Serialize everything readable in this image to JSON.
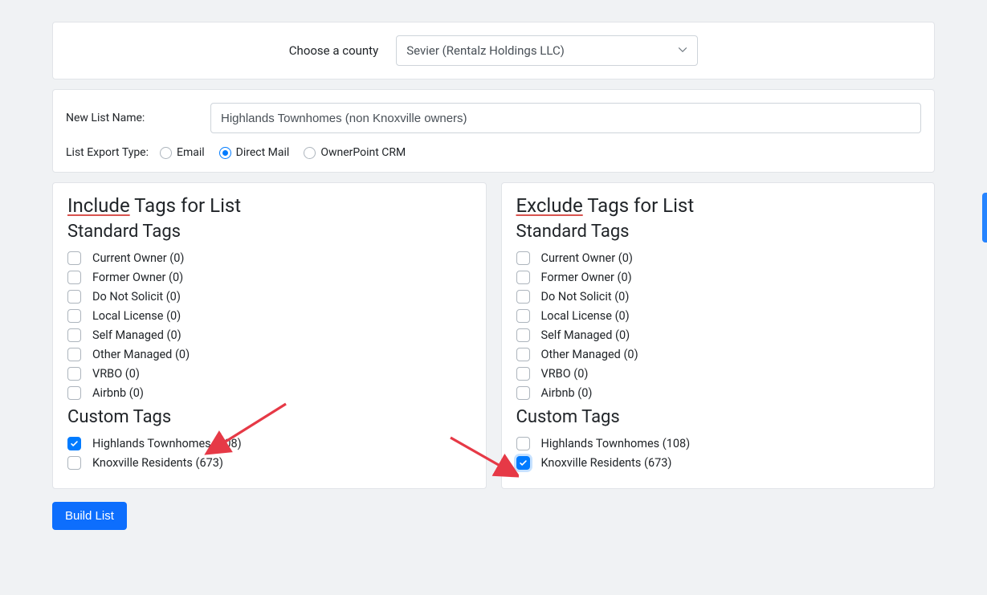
{
  "county": {
    "label": "Choose a county",
    "selected": "Sevier  (Rentalz Holdings LLC)"
  },
  "listName": {
    "label": "New List Name:",
    "value": "Highlands Townhomes (non Knoxville owners)"
  },
  "exportType": {
    "label": "List Export Type:",
    "options": [
      {
        "id": "email",
        "label": "Email",
        "checked": false
      },
      {
        "id": "direct-mail",
        "label": "Direct Mail",
        "checked": true
      },
      {
        "id": "ownerpoint-crm",
        "label": "OwnerPoint CRM",
        "checked": false
      }
    ]
  },
  "include": {
    "titlePrefix": "Include",
    "titleSuffix": " Tags for List",
    "standardHeading": "Standard Tags",
    "customHeading": "Custom Tags",
    "standard": [
      {
        "label": "Current Owner (0)",
        "checked": false
      },
      {
        "label": "Former Owner (0)",
        "checked": false
      },
      {
        "label": "Do Not Solicit (0)",
        "checked": false
      },
      {
        "label": "Local License (0)",
        "checked": false
      },
      {
        "label": "Self Managed (0)",
        "checked": false
      },
      {
        "label": "Other Managed (0)",
        "checked": false
      },
      {
        "label": "VRBO (0)",
        "checked": false
      },
      {
        "label": "Airbnb (0)",
        "checked": false
      }
    ],
    "custom": [
      {
        "label": "Highlands Townhomes (108)",
        "checked": true,
        "halo": false
      },
      {
        "label": "Knoxville Residents (673)",
        "checked": false,
        "halo": false
      }
    ]
  },
  "exclude": {
    "titlePrefix": "Exclude",
    "titleSuffix": " Tags for List",
    "standardHeading": "Standard Tags",
    "customHeading": "Custom Tags",
    "standard": [
      {
        "label": "Current Owner (0)",
        "checked": false
      },
      {
        "label": "Former Owner (0)",
        "checked": false
      },
      {
        "label": "Do Not Solicit (0)",
        "checked": false
      },
      {
        "label": "Local License (0)",
        "checked": false
      },
      {
        "label": "Self Managed (0)",
        "checked": false
      },
      {
        "label": "Other Managed (0)",
        "checked": false
      },
      {
        "label": "VRBO (0)",
        "checked": false
      },
      {
        "label": "Airbnb (0)",
        "checked": false
      }
    ],
    "custom": [
      {
        "label": "Highlands Townhomes (108)",
        "checked": false,
        "halo": false
      },
      {
        "label": "Knoxville Residents (673)",
        "checked": true,
        "halo": true
      }
    ]
  },
  "buildButton": "Build List"
}
